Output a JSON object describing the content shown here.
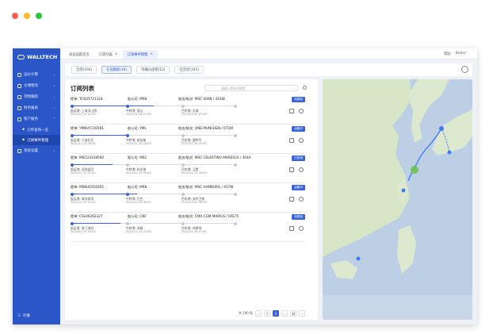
{
  "window_dots": [
    "#ff5f57",
    "#febc2e",
    "#28c840"
  ],
  "brand": "WALLTECH",
  "sidebar": {
    "items": [
      {
        "label": "运价计算",
        "icon": "calculator-icon"
      },
      {
        "label": "仓储物流",
        "icon": "warehouse-icon"
      },
      {
        "label": "货物跟踪",
        "icon": "tracking-icon"
      },
      {
        "label": "财务报表",
        "icon": "finance-icon"
      },
      {
        "label": "客户服务",
        "icon": "service-icon"
      }
    ],
    "sub_items": [
      "订单查询一览",
      "订阅事件管理"
    ],
    "after": [
      {
        "label": "系统设置",
        "icon": "settings-icon"
      }
    ],
    "footer": "折叠"
  },
  "page_tabs": [
    {
      "label": "海运追踪首页",
      "active": false
    },
    {
      "label": "订阅列表",
      "active": false
    },
    {
      "label": "订阅事件管理",
      "active": true
    }
  ],
  "topbar_right": [
    "帮助",
    "Bodor"
  ],
  "filters": [
    {
      "label": "全部(190)",
      "active": false
    },
    {
      "label": "在途跟踪(36)",
      "active": true
    },
    {
      "label": "待确认提柜(12)",
      "active": false
    },
    {
      "label": "已完结(142)",
      "active": false
    }
  ],
  "panel": {
    "title": "订阅列表",
    "search_placeholder": "请输入提单号搜索"
  },
  "orders": [
    {
      "bl": "提单: TCKU5721324",
      "carrier": "船公司: MSK",
      "vessel": "船名/航次: MSC SIXIN / 416W",
      "badge": "待提柜",
      "pol": "起运港: 上海洋山港",
      "pol_date": "2024-01-12 11:30",
      "mid": "中转港: 釜山",
      "mid_date": "2024-01-18 17:00",
      "pod": "目的港: 长滩",
      "pod_date": "2024-03-03 12:00",
      "progress": 0.5
    },
    {
      "bl": "提单: YMNV5720591",
      "carrier": "船公司: YML",
      "vessel": "船名/航次: ONE MUNCHEN / 072W",
      "badge": "运输中",
      "pol": "起运港: 宁波北仑",
      "pol_date": "2024-01-14 08:00",
      "mid": "中转港: 新加坡",
      "mid_date": "2024-01-24 18:00",
      "pod": "目的港: 鹿特丹",
      "pod_date": "2024-02-26 10:00",
      "progress": 0.35
    },
    {
      "bl": "提单: MSCU4318560",
      "carrier": "船公司: MSC",
      "vessel": "船名/航次: MSC CELESTINO MARESCA / 404A",
      "badge": "已到港",
      "pol": "起运港: 深圳盐田",
      "pol_date": "2024-01-07 22:00",
      "mid": "中转港: 科伦坡",
      "mid_date": "2024-01-19 09:00",
      "pod": "目的港: 汉堡",
      "pod_date": "2024-02-12 16:00",
      "progress": 0.25
    },
    {
      "bl": "提单: MSKU6354265",
      "carrier": "船公司: MSK",
      "vessel": "船名/航次: MSC HAMBURG / 417W",
      "badge": "运输中",
      "pol": "起运港: 青岛前湾",
      "pol_date": "2024-01-10 13:00",
      "mid": "中转港: 巴生",
      "mid_date": "2024-01-20 06:00",
      "pod": "目的港: 安特卫普",
      "pod_date": "2024-03-01 08:00",
      "progress": 0.4
    },
    {
      "bl": "提单: CSLU6262327",
      "carrier": "船公司: CNF",
      "vessel": "船名/航次: CMA CGM MARIUS / 0FE75",
      "badge": "待提柜",
      "pol": "起运港: 厦门海沧",
      "pol_date": "2024-01-09 15:00",
      "mid": "中转港: 高雄",
      "mid_date": "2024-01-13 20:00",
      "pod": "目的港: 休斯顿",
      "pod_date": "2024-02-18 11:00",
      "progress": 0.3
    }
  ],
  "pager": {
    "total": "共 190 条",
    "pages": [
      "1",
      "2",
      "...",
      "34"
    ],
    "current": "2"
  },
  "colors": {
    "sidebar": "#2b56c8",
    "accent": "#3a64d8",
    "route": "#3b7cf5",
    "vessel": "#6cc24a"
  }
}
